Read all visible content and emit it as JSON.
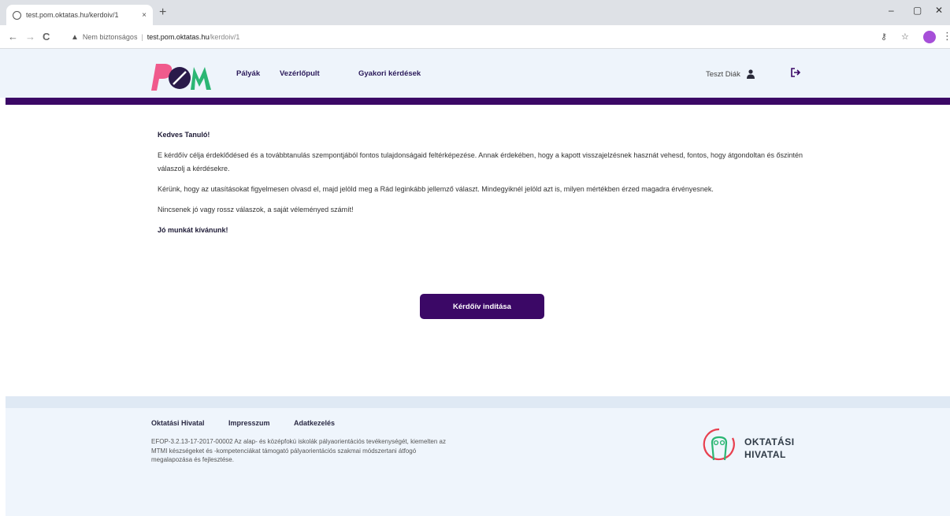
{
  "browser": {
    "tab_title": "test.pom.oktatas.hu/kerdoiv/1",
    "tab_close": "×",
    "new_tab": "+",
    "back": "←",
    "forward": "→",
    "reload": "C",
    "not_secure": "Nem biztonságos",
    "url_host": "test.pom.oktatas.hu",
    "url_path": "/kerdoiv/1",
    "minimize": "–",
    "maximize": "▢",
    "close": "✕",
    "menu": "⋮"
  },
  "header": {
    "nav": [
      "Pályák",
      "Vezérlőpult",
      "Gyakori kérdések"
    ],
    "user_name": "Teszt Diák"
  },
  "main": {
    "greeting": "Kedves Tanuló!",
    "paragraphs": [
      "E kérdőív célja érdeklődésed és a továbbtanulás szempontjából fontos tulajdonságaid feltérképezése. Annak érdekében, hogy a kapott visszajelzésnek hasznát vehesd, fontos, hogy átgondoltan és őszintén válaszolj a kérdésekre.",
      "Kérünk, hogy az utasításokat figyelmesen olvasd el, majd jelöld meg a Rád leginkább jellemző választ. Mindegyiknél jelöld azt is, milyen mértékben érzed magadra érvényesnek.",
      "Nincsenek jó vagy rossz válaszok, a saját véleményed számít!"
    ],
    "closing": "Jó munkát kívánunk!",
    "start_button": "Kérdőív indítása"
  },
  "footer": {
    "links": [
      "Oktatási Hivatal",
      "Impresszum",
      "Adatkezelés"
    ],
    "description": "EFOP-3.2.13-17-2017-00002 Az alap- és középfokú iskolák pályaorientációs tevékenységét, kiemelten az MTMI készségeket és -kompetenciákat támogató pályaorientációs szakmai módszertani átfogó megalapozása és fejlesztése.",
    "org_line1": "OKTATÁSI",
    "org_line2": "HIVATAL"
  },
  "colors": {
    "primary": "#3b0866",
    "header_bg": "#eef4fb",
    "footer_bg": "#eff5fc",
    "logo_pink": "#f05a8c",
    "logo_green": "#2bb673"
  }
}
